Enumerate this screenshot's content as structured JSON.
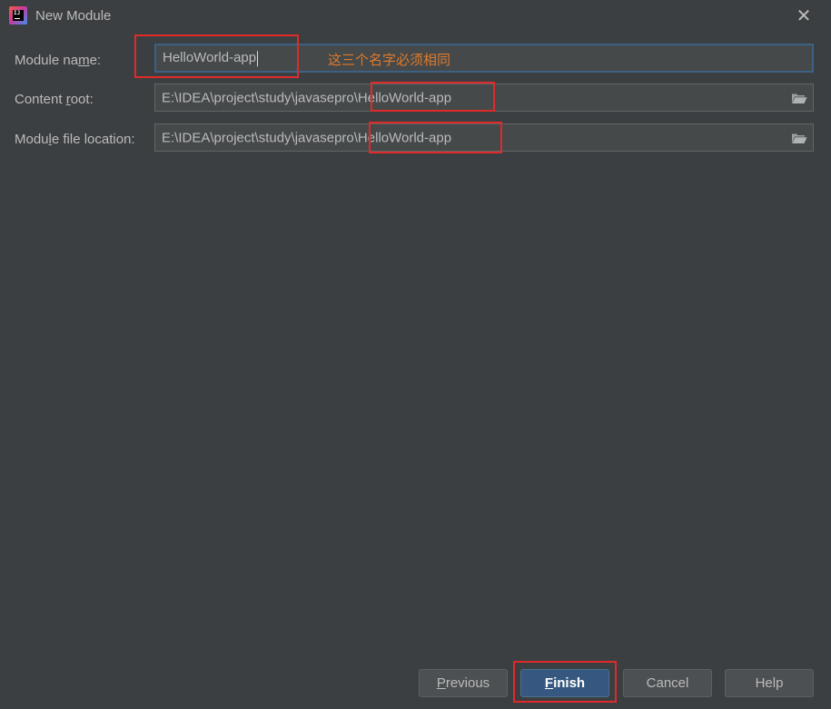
{
  "window": {
    "title": "New Module",
    "close_glyph": "✕"
  },
  "form": {
    "module_name": {
      "label_pre": "Module na",
      "label_mnemonic": "m",
      "label_post": "e:",
      "value": "HelloWorld-app"
    },
    "content_root": {
      "label_pre": "Content ",
      "label_mnemonic": "r",
      "label_post": "oot:",
      "value_prefix": "E:\\IDEA\\project\\study\\javasepro",
      "value_suffix": "\\HelloWorld-app"
    },
    "module_file_location": {
      "label_pre": "Modu",
      "label_mnemonic": "l",
      "label_post": "e file location:",
      "value_prefix": "E:\\IDEA\\project\\study\\javasepro",
      "value_suffix": "\\HelloWorld-app"
    }
  },
  "annotation": {
    "text": "这三个名字必须相同",
    "color": "#e07a2b",
    "highlight_color": "#e02a2a"
  },
  "buttons": {
    "previous": {
      "mnemonic": "P",
      "rest": "revious"
    },
    "finish": {
      "mnemonic": "F",
      "rest": "inish"
    },
    "cancel": "Cancel",
    "help": "Help"
  },
  "icons": {
    "app": "intellij-idea-icon",
    "close": "close-icon",
    "browse": "folder-open-icon"
  }
}
